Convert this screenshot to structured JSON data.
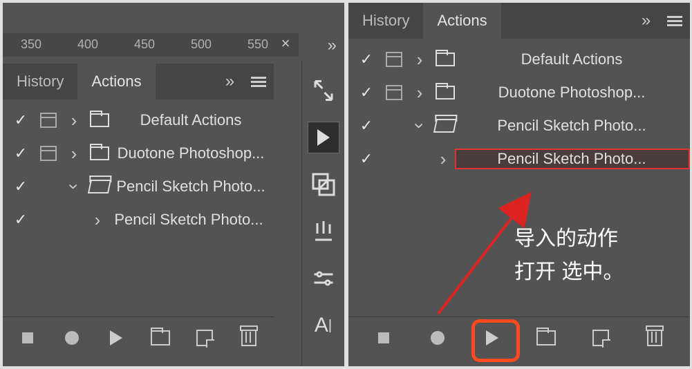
{
  "left": {
    "ruler_ticks": [
      "350",
      "400",
      "450",
      "500",
      "550"
    ],
    "tabs": {
      "history": "History",
      "actions": "Actions"
    },
    "items": [
      {
        "label": "Default Actions"
      },
      {
        "label": "Duotone Photoshop..."
      },
      {
        "label": "Pencil Sketch Photo..."
      },
      {
        "label": "Pencil Sketch Photo..."
      }
    ]
  },
  "right": {
    "tabs": {
      "history": "History",
      "actions": "Actions"
    },
    "items": [
      {
        "label": "Default Actions"
      },
      {
        "label": "Duotone Photoshop..."
      },
      {
        "label": "Pencil Sketch Photo..."
      },
      {
        "label": "Pencil Sketch Photo..."
      }
    ],
    "annotation_line1": "导入的动作",
    "annotation_line2": "打开 选中。"
  }
}
